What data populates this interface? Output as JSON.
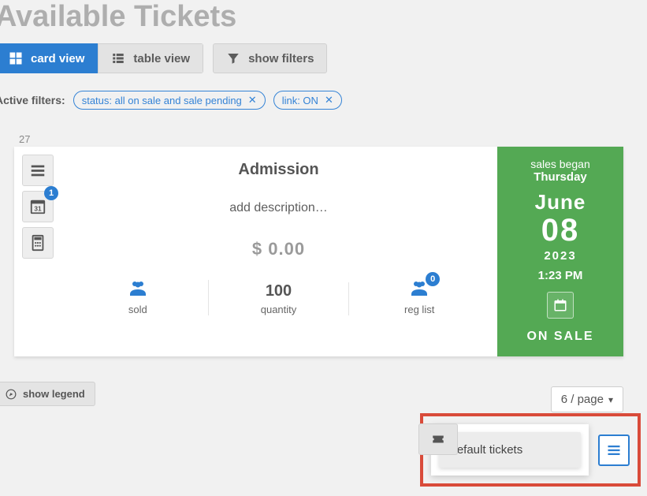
{
  "page_title": "Available Tickets",
  "toolbar": {
    "card_view": "card view",
    "table_view": "table view",
    "show_filters": "show filters"
  },
  "filters": {
    "label": "Active filters:",
    "items": [
      "status: all on sale and sale pending",
      "link: ON"
    ]
  },
  "card": {
    "id": "27",
    "title": "Admission",
    "description_placeholder": "add description…",
    "price": "$ 0.00",
    "calendar_badge": "1",
    "stats": {
      "sold_label": "sold",
      "quantity_value": "100",
      "quantity_label": "quantity",
      "reglist_label": "reg list",
      "reglist_badge": "0"
    },
    "side": {
      "l1": "sales began",
      "l2": "Thursday",
      "month": "June",
      "day": "08",
      "year": "2023",
      "time": "1:23 PM",
      "status": "ON SALE"
    }
  },
  "legend_label": "show legend",
  "pager_label": "6 / page",
  "default_tickets_value": "Default tickets"
}
